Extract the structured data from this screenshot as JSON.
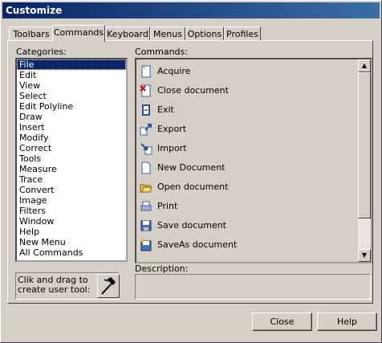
{
  "window": {
    "title": "Customize"
  },
  "tabs": [
    {
      "label": "Toolbars",
      "active": false
    },
    {
      "label": "Commands",
      "active": true
    },
    {
      "label": "Keyboard",
      "active": false
    },
    {
      "label": "Menus",
      "active": false
    },
    {
      "label": "Options",
      "active": false
    },
    {
      "label": "Profiles",
      "active": false
    }
  ],
  "categories": {
    "label": "Categories:",
    "selected_index": 0,
    "items": [
      "File",
      "Edit",
      "View",
      "Select",
      "Edit Polyline",
      "Draw",
      "Insert",
      "Modify",
      "Correct",
      "Tools",
      "Measure",
      "Trace",
      "Convert",
      "Image",
      "Filters",
      "Window",
      "Help",
      "New Menu",
      "All Commands"
    ]
  },
  "commands": {
    "label": "Commands:",
    "items": [
      {
        "label": "Acquire",
        "icon": "acquire-icon"
      },
      {
        "label": "Close document",
        "icon": "close-document-icon"
      },
      {
        "label": "Exit",
        "icon": "exit-icon"
      },
      {
        "label": "Export",
        "icon": "export-icon"
      },
      {
        "label": "Import",
        "icon": "import-icon"
      },
      {
        "label": "New Document",
        "icon": "new-document-icon"
      },
      {
        "label": "Open document",
        "icon": "open-document-icon"
      },
      {
        "label": "Print",
        "icon": "print-icon"
      },
      {
        "label": "Save document",
        "icon": "save-document-icon"
      },
      {
        "label": "SaveAs document",
        "icon": "save-as-document-icon"
      }
    ]
  },
  "user_tool": {
    "hint": "Clik and drag to create user tool:",
    "icon": "hammer-icon"
  },
  "description": {
    "label": "Description:",
    "text": ""
  },
  "buttons": {
    "close": "Close",
    "help": "Help"
  }
}
